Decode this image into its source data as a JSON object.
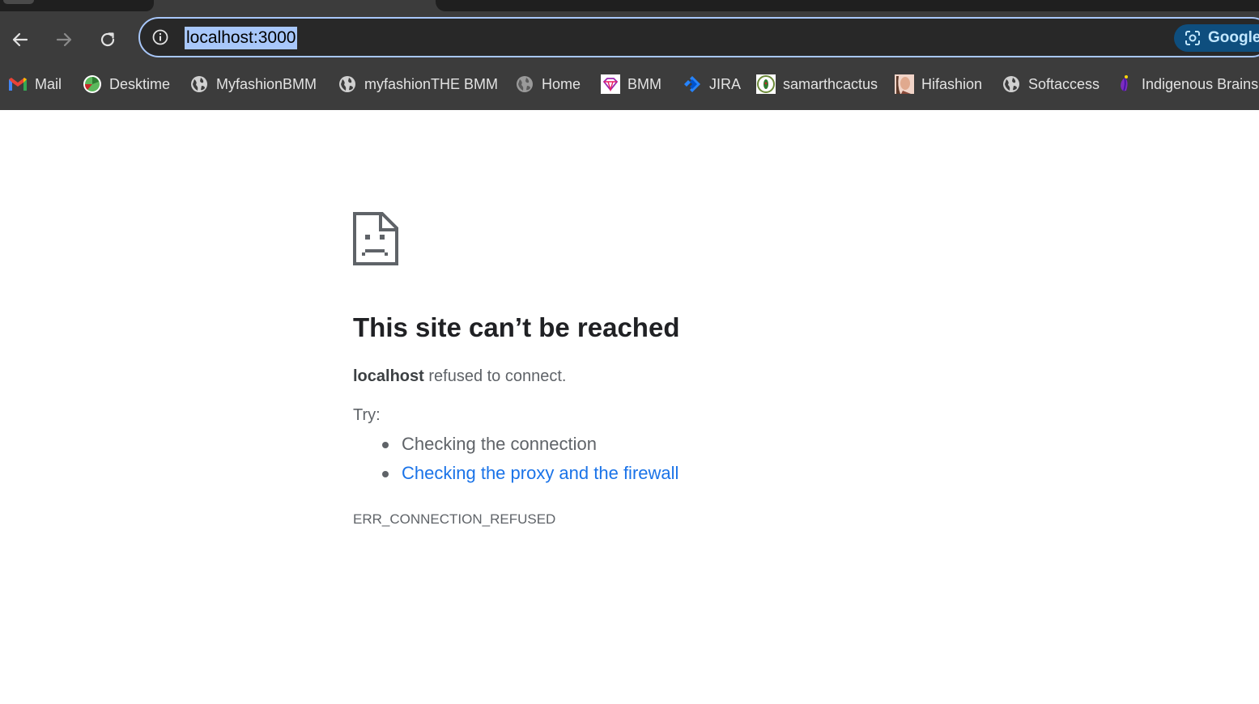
{
  "browser": {
    "url": "localhost:3000",
    "google_chip_label": "Google",
    "bookmarks": [
      {
        "label": "Mail",
        "icon": "gmail-icon"
      },
      {
        "label": "Desktime",
        "icon": "desktime-icon"
      },
      {
        "label": "MyfashionBMM",
        "icon": "globe-icon"
      },
      {
        "label": "myfashionTHE BMM",
        "icon": "globe-icon"
      },
      {
        "label": "Home",
        "icon": "globe-icon"
      },
      {
        "label": "BMM",
        "icon": "bmm-icon"
      },
      {
        "label": "JIRA",
        "icon": "jira-icon"
      },
      {
        "label": "samarthcactus",
        "icon": "samarthcactus-icon"
      },
      {
        "label": "Hifashion",
        "icon": "hifashion-icon"
      },
      {
        "label": "Softaccess",
        "icon": "globe-icon"
      },
      {
        "label": "Indigenous Brains",
        "icon": "indigenous-brains-icon"
      }
    ]
  },
  "error_page": {
    "icon": "sad-page-icon",
    "title": "This site can’t be reached",
    "host": "localhost",
    "summary_rest": " refused to connect.",
    "try_label": "Try:",
    "suggestions": [
      {
        "text": "Checking the connection",
        "is_link": false
      },
      {
        "text": "Checking the proxy and the firewall",
        "is_link": true
      }
    ],
    "error_code": "ERR_CONNECTION_REFUSED"
  },
  "colors": {
    "chrome_bg": "#3c3c3c",
    "omnibox_bg": "#282828",
    "selection": "#a8c7fa",
    "link": "#1a73e8",
    "text_secondary": "#5f6368",
    "heading": "#202124"
  }
}
